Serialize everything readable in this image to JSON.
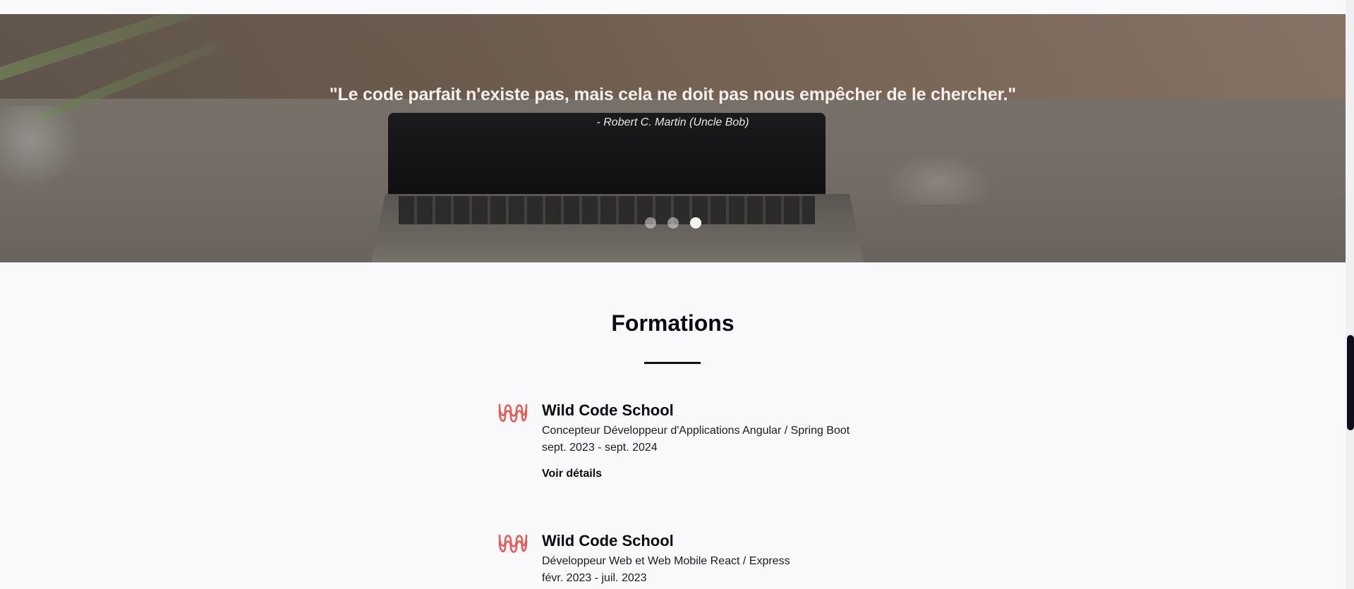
{
  "carousel": {
    "quote": "\"Le code parfait n'existe pas, mais cela ne doit pas nous empêcher de le chercher.\"",
    "author": "- Robert C. Martin (Uncle Bob)",
    "slide_count": 3,
    "active_slide": 3
  },
  "formations": {
    "title": "Formations",
    "items": [
      {
        "school": "Wild Code School",
        "diploma": "Concepteur Développeur d'Applications Angular / Spring Boot",
        "dates": "sept. 2023 - sept. 2024",
        "details_label": "Voir détails",
        "logo_icon": "wild-code-school-logo-icon"
      },
      {
        "school": "Wild Code School",
        "diploma": "Développeur Web et Web Mobile React / Express",
        "dates": "févr. 2023 - juil. 2023",
        "logo_icon": "wild-code-school-logo-icon"
      }
    ]
  },
  "colors": {
    "background": "#f9f9fc",
    "text": "#0b0b14",
    "logo_accent": "#e35d5b",
    "scrollbar_thumb": "#0d0d1c"
  }
}
